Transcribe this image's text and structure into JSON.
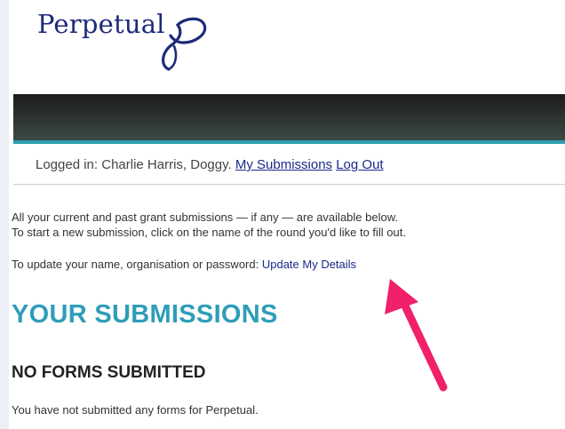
{
  "brand": {
    "name": "Perpetual",
    "color": "#1f2a7a"
  },
  "header": {
    "bar_color": "#2c3533",
    "accent_color": "#2a9fb2"
  },
  "login": {
    "prefix": "Logged in: Charlie Harris, Doggy.",
    "my_submissions_link": "My Submissions",
    "logout_link": "Log Out"
  },
  "intro": {
    "line1": "All your current and past grant submissions — if any — are available below.",
    "line2": "To start a new submission, click on the name of the round you'd like to fill out."
  },
  "update": {
    "prefix": "To update your name, organisation or password:",
    "link": "Update My Details"
  },
  "main": {
    "title": "YOUR SUBMISSIONS",
    "title_color": "#2f9db8",
    "subtitle": "NO FORMS SUBMITTED",
    "empty_message": "You have not submitted any forms for Perpetual."
  },
  "annotation": {
    "icon": "pointer-arrow-icon",
    "color": "#f0206a"
  }
}
